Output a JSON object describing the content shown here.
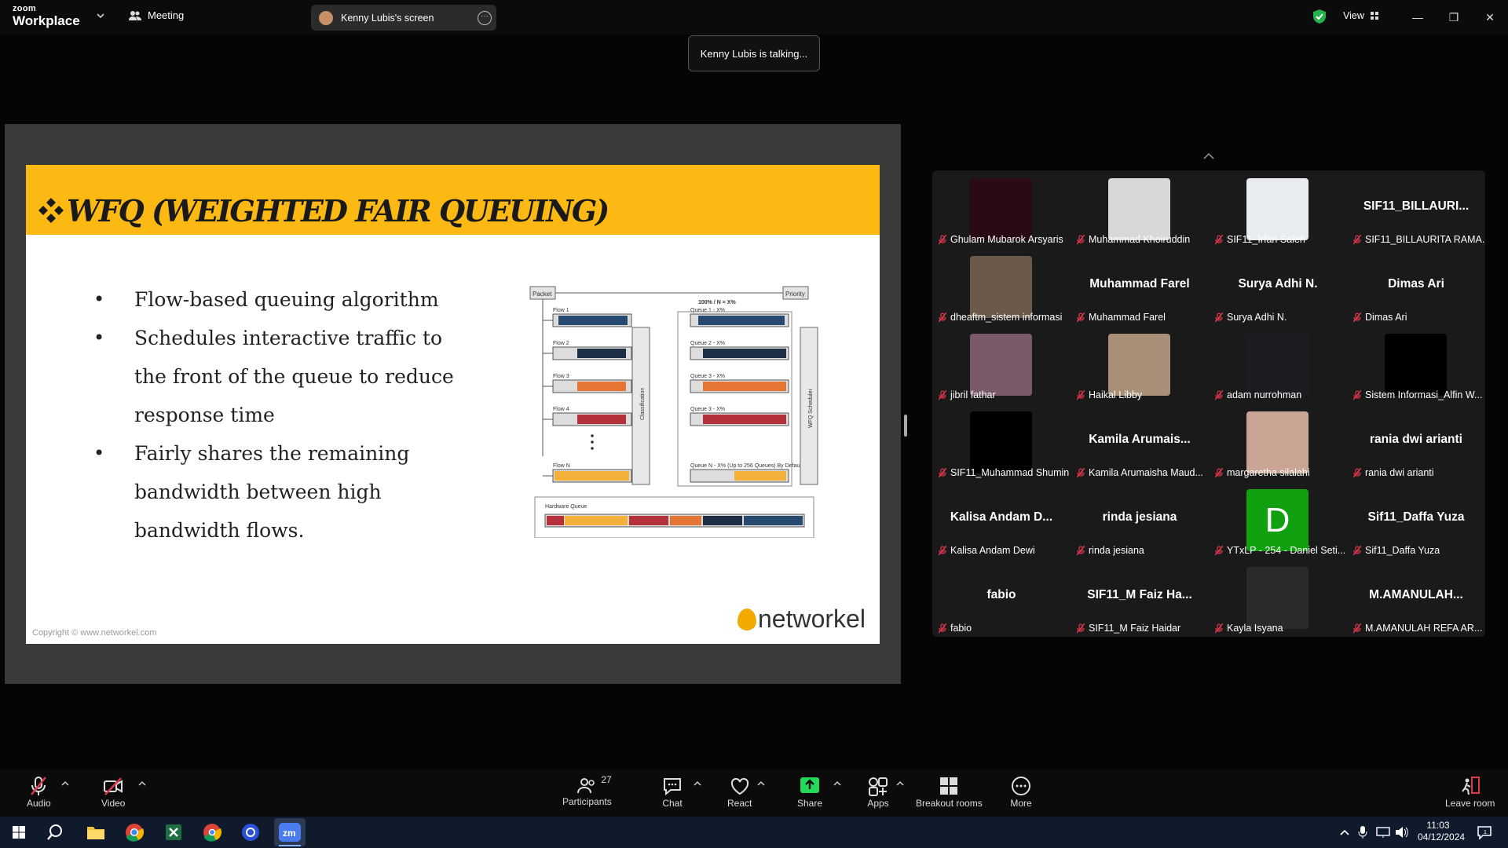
{
  "app": {
    "logo_line1": "zoom",
    "logo_line2": "Workplace",
    "meeting_label": "Meeting",
    "share_tab": "Kenny Lubis's screen",
    "view_label": "View",
    "toast": "Kenny Lubis is talking..."
  },
  "slide": {
    "title": "WFQ (WEIGHTED FAIR QUEUING)",
    "bullets": [
      "Flow-based queuing algorithm",
      "Schedules interactive traffic to the front of the queue to reduce response time",
      "Fairly shares the remaining bandwidth between high bandwidth flows."
    ],
    "copyright": "Copyright © www.networkel.com",
    "logo_text": "networkel",
    "diagram": {
      "packet": "Packet",
      "priority": "Priority",
      "ratio": "100% / N = X%",
      "flows": [
        "Flow 1",
        "Flow 2",
        "Flow 3",
        "Flow 4",
        "Flow N"
      ],
      "queues": [
        "Queue 1 - X%",
        "Queue 2 - X%",
        "Queue 3 - X%",
        "Queue 3 - X%",
        "Queue N - X% (Up to 256 Queues) By Default"
      ],
      "classification": "Classification",
      "scheduler": "WFQ Scheduler",
      "hardware_queue": "Hardware Queue"
    }
  },
  "participants": [
    {
      "name": "Ghulam Mubarok Arsyaris",
      "pic": "#2a0a14"
    },
    {
      "name": "Muhammad Khoiruddin",
      "pic": "#d8d8d8"
    },
    {
      "name": "SIF11_Irfan Saleh",
      "pic": "#e8ecf0"
    },
    {
      "name": "SIF11_BILLAURITA RAMA...",
      "big": "SIF11_BILLAURI..."
    },
    {
      "name": "dheaftm_sistem informasi",
      "pic": "#6b5a4a"
    },
    {
      "name": "Muhammad Farel",
      "big": "Muhammad Farel"
    },
    {
      "name": "Surya Adhi N.",
      "big": "Surya Adhi N."
    },
    {
      "name": "Dimas Ari",
      "big": "Dimas Ari"
    },
    {
      "name": "jibril fathar",
      "pic": "#7a5a6a"
    },
    {
      "name": "Haikal Libby",
      "pic": "#a89078"
    },
    {
      "name": "adam nurrohman",
      "pic": "#1a1c22"
    },
    {
      "name": "Sistem Informasi_Alfin W...",
      "pic": "#000000"
    },
    {
      "name": "SIF11_Muhammad Shumin",
      "pic": "#000000"
    },
    {
      "name": "Kamila Arumaisha Maud...",
      "big": "Kamila Arumais..."
    },
    {
      "name": "margaretha silalahi",
      "pic": "#caa494"
    },
    {
      "name": "rania dwi arianti",
      "big": "rania dwi arianti"
    },
    {
      "name": "Kalisa Andam Dewi",
      "big": "Kalisa Andam D..."
    },
    {
      "name": "rinda jesiana",
      "big": "rinda jesiana"
    },
    {
      "name": "YTxLP - 254 - Daniel Seti...",
      "pic": "#10a010",
      "letter": "D"
    },
    {
      "name": "Sif11_Daffa Yuza",
      "big": "Sif11_Daffa Yuza"
    },
    {
      "name": "fabio",
      "big": "fabio"
    },
    {
      "name": "SIF11_M Faiz Haidar",
      "big": "SIF11_M Faiz Ha..."
    },
    {
      "name": "Kayla Isyana",
      "pic": "#2a2a2a"
    },
    {
      "name": "M.AMANULAH REFA AR...",
      "big": "M.AMANULAH..."
    }
  ],
  "toolbar": {
    "audio": "Audio",
    "video": "Video",
    "participants": "Participants",
    "participants_count": "27",
    "chat": "Chat",
    "react": "React",
    "share": "Share",
    "apps": "Apps",
    "breakout": "Breakout rooms",
    "more": "More",
    "leave": "Leave room"
  },
  "taskbar": {
    "time": "11:03",
    "date": "04/12/2024"
  },
  "colors": {
    "accent": "#fdb913",
    "share_green": "#23d959",
    "mute_red": "#e0384b"
  }
}
